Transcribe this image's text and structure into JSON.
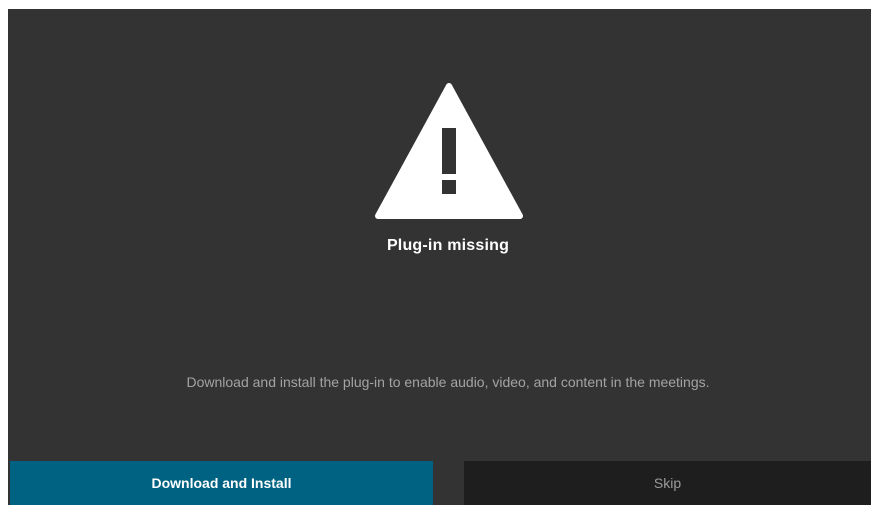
{
  "dialog": {
    "icon": "warning-triangle-icon",
    "title": "Plug-in missing",
    "message": "Download and install the plug-in to enable audio, video, and content in the meetings.",
    "primary_button_label": "Download and Install",
    "secondary_button_label": "Skip"
  },
  "colors": {
    "background": "#333333",
    "primary_button": "#006282",
    "secondary_button": "#1e1e1e",
    "message_text": "#a3a3a3"
  }
}
